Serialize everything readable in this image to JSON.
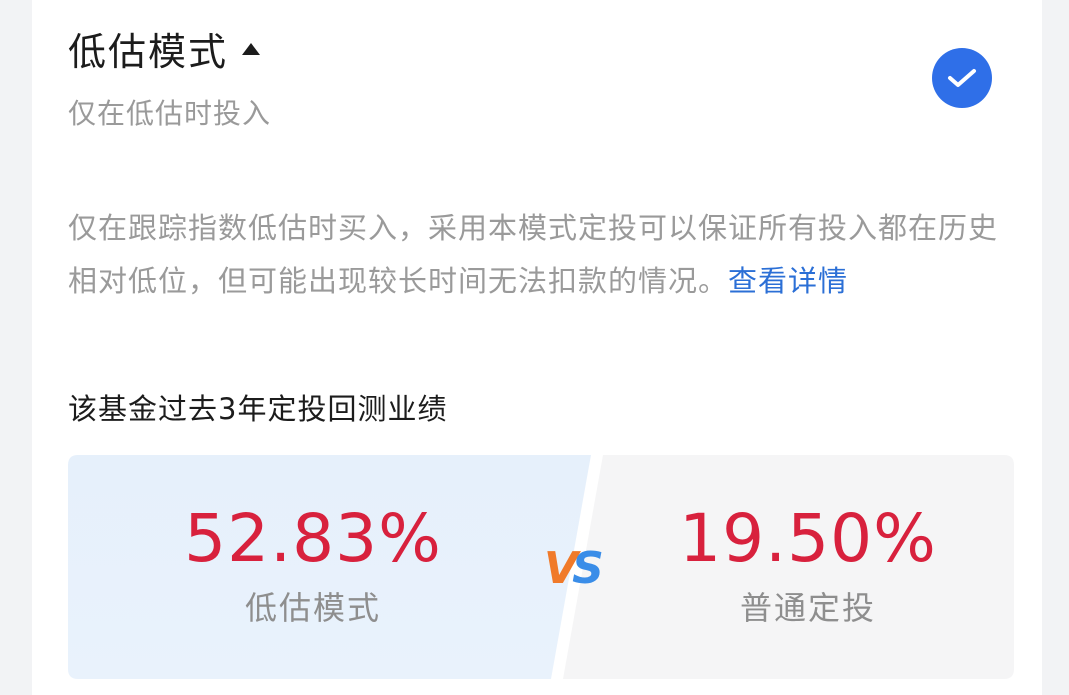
{
  "mode": {
    "title": "低估模式",
    "subtitle": "仅在低估时投入",
    "expand_icon": "caret-up-icon",
    "selected_icon": "check-icon",
    "selected_color": "#2f6fe8"
  },
  "description": {
    "text": "仅在跟踪指数低估时买入，采用本模式定投可以保证所有投入都在历史相对低位，但可能出现较长时间无法扣款的情况。",
    "link": "查看详情"
  },
  "backtest": {
    "title": "该基金过去3年定投回测业绩",
    "left": {
      "value": "52.83%",
      "label": "低估模式"
    },
    "vs_v": "V",
    "vs_s": "S",
    "right": {
      "value": "19.50%",
      "label": "普通定投"
    },
    "value_color": "#d8213d"
  }
}
